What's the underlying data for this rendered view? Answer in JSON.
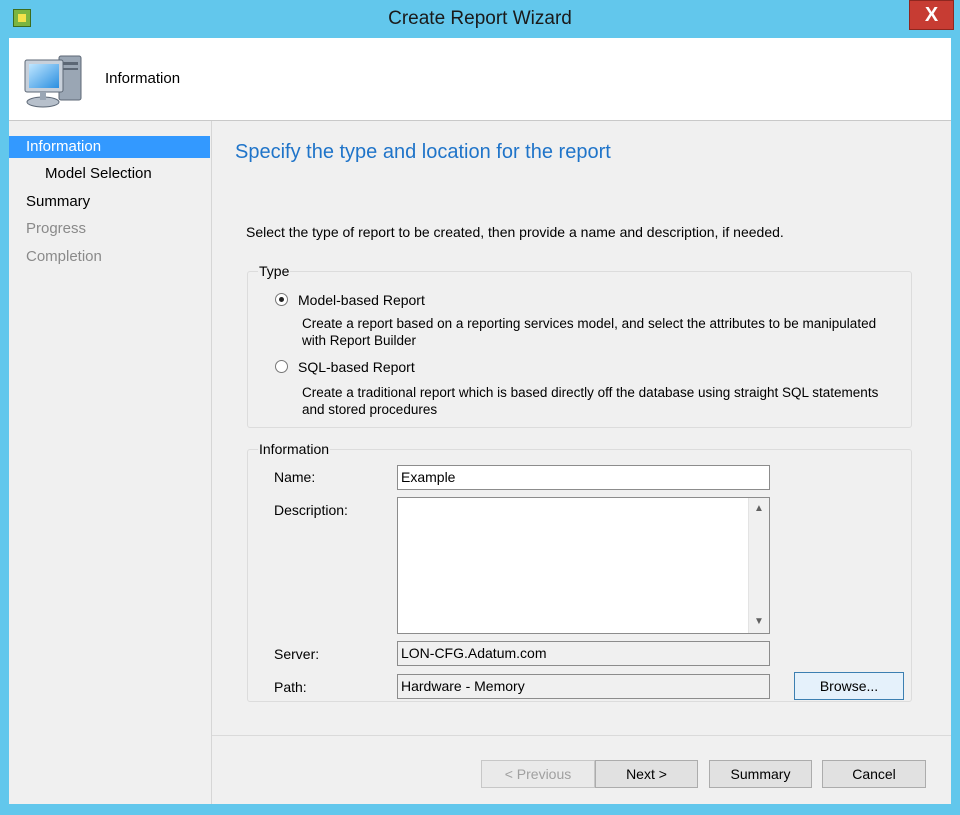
{
  "window": {
    "title": "Create Report Wizard",
    "close_glyph": "X"
  },
  "header": {
    "label": "Information",
    "icon": "computer-icon"
  },
  "nav": {
    "items": [
      {
        "label": "Information",
        "state": "active"
      },
      {
        "label": "Model Selection",
        "state": "normal"
      },
      {
        "label": "Summary",
        "state": "normal"
      },
      {
        "label": "Progress",
        "state": "disabled"
      },
      {
        "label": "Completion",
        "state": "disabled"
      }
    ]
  },
  "main": {
    "heading": "Specify the type and location for the report",
    "instruction": "Select the type of report to be created, then provide a name and description, if needed."
  },
  "type_group": {
    "label": "Type",
    "options": [
      {
        "label": "Model-based Report",
        "description": "Create a report based on a reporting services model, and select the attributes to be manipulated with Report Builder",
        "checked": true
      },
      {
        "label": "SQL-based Report",
        "description": "Create a traditional report which is based directly off the database using straight SQL statements and stored procedures",
        "checked": false
      }
    ]
  },
  "info_group": {
    "label": "Information",
    "name_label": "Name:",
    "name_value": "Example",
    "description_label": "Description:",
    "description_value": "",
    "server_label": "Server:",
    "server_value": "LON-CFG.Adatum.com",
    "path_label": "Path:",
    "path_value": "Hardware - Memory",
    "browse_label": "Browse..."
  },
  "buttons": {
    "previous": "< Previous",
    "next": "Next >",
    "summary": "Summary",
    "cancel": "Cancel"
  },
  "colors": {
    "accent": "#3399ff",
    "heading": "#1f74c9",
    "frame": "#62c7ec",
    "close": "#c73c33"
  }
}
